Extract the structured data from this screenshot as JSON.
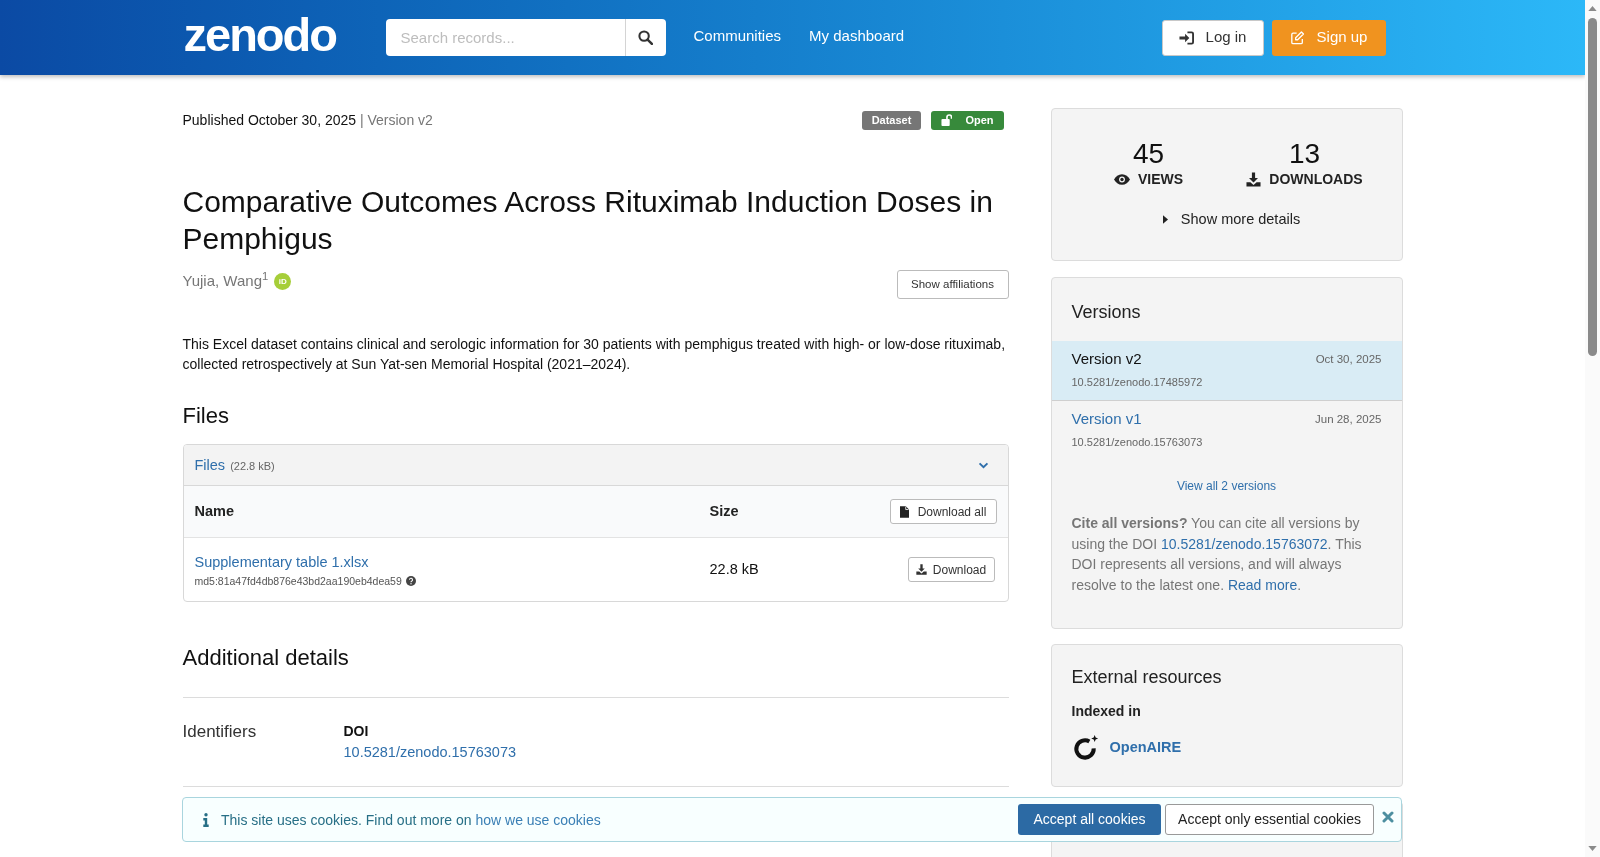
{
  "header": {
    "logo": "zenodo",
    "search": {
      "placeholder": "Search records..."
    },
    "nav": [
      "Communities",
      "My dashboard"
    ],
    "buttons": [
      {
        "label": "Log in",
        "kind": "login"
      },
      {
        "label": "Sign up",
        "kind": "signup"
      }
    ]
  },
  "record": {
    "published": "Published October 30, 2025",
    "separator": "|",
    "version": "Version v2",
    "badges": [
      {
        "label": "Dataset",
        "kind": "resource_type"
      },
      {
        "label": "Open",
        "kind": "access_right"
      }
    ],
    "title": "Comparative Outcomes Across Rituximab Induction Doses in Pemphigus",
    "creators": [
      {
        "name": "Yujia, Wang$^{1}$",
        "orcid": "iD"
      }
    ],
    "show_affiliations": "Show affiliations",
    "description": "This Excel dataset contains clinical and serologic information for 30 patients with pemphigus treated with high- or low-dose rituximab, collected retrospectively at Sun Yat-sen Memorial Hospital (2021–2024)."
  },
  "files": {
    "heading": "Files",
    "panel": {
      "label": "Files",
      "size": "(22.8 kB)",
      "expanded": true
    },
    "columns": [
      "Name",
      "Size"
    ],
    "download_all": "Download all",
    "rows": [
      {
        "name": "Supplementary table 1.xlsx",
        "checksum": "md5:81a47fd4db876e43bd2aa190eb4dea59",
        "size": "22.8 kB",
        "action": "Download"
      }
    ]
  },
  "additional_details": {
    "heading": "Additional details",
    "sections": [
      {
        "label": "Identifiers",
        "items": [
          {
            "type": "DOI",
            "value": "10.5281/zenodo.15763073"
          }
        ]
      }
    ]
  },
  "stats": {
    "items": [
      {
        "value": "45",
        "label": "VIEWS",
        "kind": "views"
      },
      {
        "value": "13",
        "label": "DOWNLOADS",
        "kind": "downloads"
      }
    ],
    "more": "Show more details"
  },
  "versions": {
    "heading": "Versions",
    "items": [
      {
        "label": "Version v2",
        "date": "Oct 30, 2025",
        "doi": "10.5281/zenodo.17485972",
        "selected": true
      },
      {
        "label": "Version v1",
        "date": "Jun 28, 2025",
        "doi": "10.5281/zenodo.15763073",
        "selected": false
      }
    ],
    "view_all": "View all 2 versions",
    "cite": [
      {
        "kind": "text",
        "text": "**Cite all versions?** You can cite all versions by using the DOI "
      },
      {
        "kind": "doi",
        "text": "10.5281/zenodo.15763072"
      },
      {
        "kind": "text",
        "text": ". This DOI represents all versions, and will always resolve to the latest one. "
      },
      {
        "kind": "link",
        "text": "Read more"
      },
      {
        "kind": "text",
        "text": "."
      }
    ]
  },
  "external_resources": {
    "heading": "External resources",
    "subheading": "Indexed in",
    "items": [
      {
        "name": "OpenAIRE"
      }
    ]
  },
  "cookie_banner": {
    "message": "This site uses cookies. Find out more on",
    "link": "how we use cookies",
    "buttons": [
      {
        "label": "Accept all cookies",
        "kind": "primary"
      },
      {
        "label": "Accept only essential cookies",
        "kind": "secondary"
      }
    ]
  }
}
